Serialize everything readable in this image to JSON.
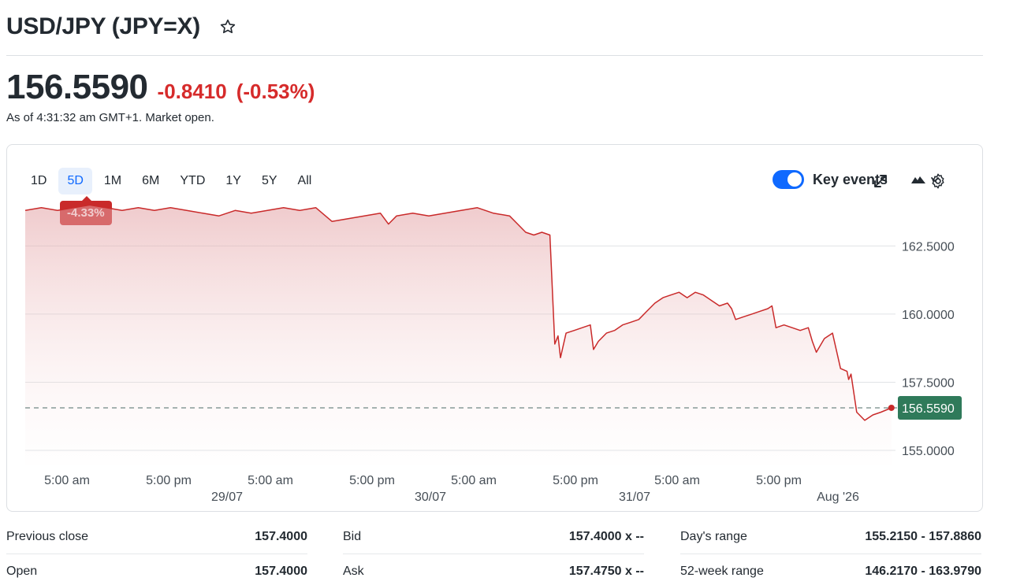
{
  "header": {
    "title": "USD/JPY (JPY=X)"
  },
  "quote": {
    "price": "156.5590",
    "change": "-0.8410",
    "change_pct": "(-0.53%)",
    "as_of": "As of 4:31:32 am GMT+1. Market open."
  },
  "toolbar": {
    "ranges": [
      "1D",
      "5D",
      "1M",
      "6M",
      "YTD",
      "1Y",
      "5Y",
      "All"
    ],
    "active_range": "5D",
    "key_events_label": "Key events",
    "key_events_on": true
  },
  "performance_badge": "-4.33%",
  "colors": {
    "line": "#c92a2a",
    "negative": "#d62b2b",
    "accent": "#0f69ff",
    "current_price_tag": "#2f7a5a"
  },
  "icons": {
    "watchlist": "star-outline-icon",
    "chart_type": "mountain-chart-icon",
    "fullscreen": "expand-icon",
    "settings": "gear-icon"
  },
  "chart_data": {
    "type": "area",
    "y_ticks": [
      "162.5000",
      "160.0000",
      "157.5000",
      "155.0000"
    ],
    "y_tick_values": [
      162.5,
      160.0,
      157.5,
      155.0
    ],
    "ylim": [
      154.48,
      164.3
    ],
    "x_ticks": [
      "5:00 am",
      "5:00 pm",
      "5:00 am",
      "5:00 pm",
      "5:00 am",
      "5:00 pm",
      "5:00 am",
      "5:00 pm"
    ],
    "date_labels": [
      "29/07",
      "30/07",
      "31/07",
      "Aug '26"
    ],
    "current_label": "156.5590",
    "current_value": 156.559,
    "grid": true,
    "xlim": [
      0,
      108
    ],
    "series": [
      {
        "x": [
          0,
          2,
          4,
          6,
          8,
          10,
          12,
          14,
          16,
          18,
          20,
          22,
          24,
          26,
          28,
          30,
          32,
          34,
          36,
          38,
          40,
          42,
          44,
          45,
          46,
          48,
          50,
          52,
          54,
          56,
          58,
          60,
          61,
          62,
          63,
          64,
          65,
          65.6,
          66,
          66.3,
          67,
          68,
          69,
          70,
          70.4,
          71,
          72,
          73,
          74,
          75,
          76,
          77,
          78,
          79,
          80,
          81,
          82,
          83,
          84,
          85,
          86,
          87,
          87.5,
          88,
          89,
          90,
          91,
          92,
          92.5,
          93,
          94,
          95,
          96,
          97,
          97.5,
          98,
          99,
          100,
          101,
          101.8,
          102,
          102.3,
          103,
          104,
          105,
          106,
          107.3
        ],
        "y": [
          163.8,
          163.9,
          163.8,
          163.9,
          164.0,
          163.9,
          163.8,
          163.9,
          163.8,
          163.9,
          163.8,
          163.7,
          163.6,
          163.8,
          163.7,
          163.8,
          163.9,
          163.8,
          163.9,
          163.4,
          163.5,
          163.6,
          163.7,
          163.3,
          163.6,
          163.7,
          163.6,
          163.7,
          163.8,
          163.9,
          163.7,
          163.6,
          163.3,
          163.0,
          162.9,
          163.0,
          162.9,
          158.9,
          159.2,
          158.4,
          159.3,
          159.4,
          159.5,
          159.6,
          158.7,
          159.0,
          159.3,
          159.4,
          159.6,
          159.7,
          159.8,
          160.1,
          160.4,
          160.6,
          160.7,
          160.8,
          160.6,
          160.8,
          160.7,
          160.5,
          160.3,
          160.4,
          160.2,
          159.8,
          159.9,
          160.0,
          160.1,
          160.2,
          160.3,
          159.5,
          159.6,
          159.5,
          159.4,
          159.5,
          159.0,
          158.6,
          159.1,
          159.3,
          158.0,
          157.9,
          157.6,
          157.8,
          156.4,
          156.1,
          156.3,
          156.4,
          156.56
        ]
      }
    ]
  },
  "stats": [
    [
      {
        "label": "Previous close",
        "value": "157.4000"
      },
      {
        "label": "Open",
        "value": "157.4000"
      }
    ],
    [
      {
        "label": "Bid",
        "value": "157.4000 x --"
      },
      {
        "label": "Ask",
        "value": "157.4750 x --"
      }
    ],
    [
      {
        "label": "Day's range",
        "value": "155.2150 - 157.8860"
      },
      {
        "label": "52-week range",
        "value": "146.2170 - 163.9790"
      }
    ]
  ]
}
